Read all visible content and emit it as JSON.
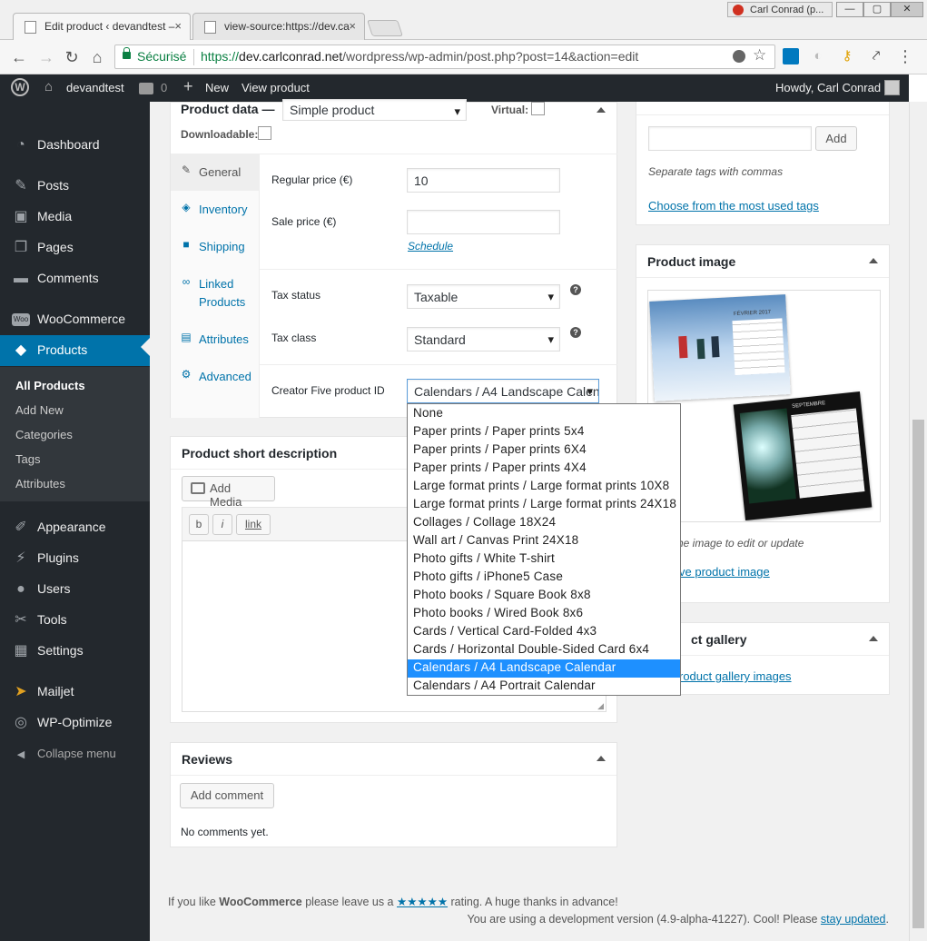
{
  "browser": {
    "tabs": [
      {
        "title": "Edit product ‹ devandtest –",
        "close": "×"
      },
      {
        "title": "view-source:https://dev.ca",
        "close": "×"
      }
    ],
    "profile": "Carl Conrad (p...",
    "window_buttons": [
      "—",
      "▢",
      "✕"
    ],
    "nav": {
      "back": "←",
      "forward": "→",
      "reload": "↻",
      "home": "⌂"
    },
    "security_label": "Sécurisé",
    "url": {
      "scheme": "https://",
      "host": "dev.carlconrad.net",
      "path": "/wordpress/wp-admin/post.php?post=14&action=edit"
    },
    "bookmark_star": "☆",
    "menu_dots": "⋮"
  },
  "adminbar": {
    "site_name": "devandtest",
    "comments_count": "0",
    "new_label": "New",
    "view_label": "View product",
    "howdy": "Howdy, Carl Conrad"
  },
  "sidebar": {
    "items": [
      {
        "label": "Dashboard",
        "icon": "◔"
      },
      {
        "label": "Posts",
        "icon": "✎"
      },
      {
        "label": "Media",
        "icon": "▣"
      },
      {
        "label": "Pages",
        "icon": "❐"
      },
      {
        "label": "Comments",
        "icon": "▬"
      },
      {
        "label": "WooCommerce",
        "icon": "Woo"
      },
      {
        "label": "Products",
        "icon": "◆"
      },
      {
        "label": "Appearance",
        "icon": "✐"
      },
      {
        "label": "Plugins",
        "icon": "⚡"
      },
      {
        "label": "Users",
        "icon": "●"
      },
      {
        "label": "Tools",
        "icon": "✂"
      },
      {
        "label": "Settings",
        "icon": "▦"
      },
      {
        "label": "Mailjet",
        "icon": "➤"
      },
      {
        "label": "WP-Optimize",
        "icon": "◎"
      },
      {
        "label": "Collapse menu",
        "icon": "◀"
      }
    ],
    "submenu": [
      "All Products",
      "Add New",
      "Categories",
      "Tags",
      "Attributes"
    ]
  },
  "product_data": {
    "title": "Product data —",
    "type_value": "Simple product",
    "virtual_label": "Virtual:",
    "downloadable_label": "Downloadable:",
    "tabs": [
      {
        "label": "General",
        "icon": "✎"
      },
      {
        "label": "Inventory",
        "icon": "◈"
      },
      {
        "label": "Shipping",
        "icon": "■"
      },
      {
        "label": "Linked Products",
        "icon": "∞"
      },
      {
        "label": "Attributes",
        "icon": "▤"
      },
      {
        "label": "Advanced",
        "icon": "⚙"
      }
    ],
    "regular_price_label": "Regular price (€)",
    "regular_price_value": "10",
    "sale_price_label": "Sale price (€)",
    "sale_price_value": "",
    "schedule_link": "Schedule",
    "tax_status_label": "Tax status",
    "tax_status_value": "Taxable",
    "tax_class_label": "Tax class",
    "tax_class_value": "Standard",
    "help_icon": "?",
    "creator_label": "Creator Five product ID",
    "creator_value": "Calendars / A4 Landscape Calendar",
    "creator_options": [
      "None",
      "Paper prints / Paper prints 5x4",
      "Paper prints / Paper prints 6X4",
      "Paper prints / Paper prints 4X4",
      "Large format prints / Large format prints 10X8",
      "Large format prints / Large format prints 24X18",
      "Collages / Collage 18X24",
      "Wall art / Canvas Print 24X18",
      "Photo gifts / White T-shirt",
      "Photo gifts / iPhone5 Case",
      "Photo books / Square Book 8x8",
      "Photo books / Wired Book 8x6",
      "Cards / Vertical Card-Folded 4x3",
      "Cards / Horizontal Double-Sided Card 6x4",
      "Calendars / A4 Landscape Calendar",
      "Calendars / A4 Portrait Calendar"
    ],
    "highlighted_index": 14
  },
  "short_description": {
    "title": "Product short description",
    "add_media": "Add Media",
    "quicktags": [
      "b",
      "i",
      "link"
    ]
  },
  "reviews": {
    "title": "Reviews",
    "add_comment": "Add comment",
    "empty": "No comments yet."
  },
  "tags_box": {
    "add_button": "Add",
    "hint": "Separate tags with commas",
    "choose_link": "Choose from the most used tags"
  },
  "product_image": {
    "title": "Product image",
    "calendar_month_1": "FÉVRIER 2017",
    "calendar_month_2": "SEPTEMBRE",
    "hint": "he image to edit or update",
    "remove_link": "ve product image"
  },
  "product_gallery": {
    "title": "ct gallery",
    "add_link": "roduct gallery images"
  },
  "footer": {
    "woo_prefix": "If you like ",
    "woo_brand": "WooCommerce",
    "woo_mid": " please leave us a ",
    "stars": "★★★★★",
    "woo_suffix": " rating. A huge thanks in advance!",
    "version_text": "You are using a development version (4.9-alpha-41227). Cool! Please ",
    "stay_updated": "stay updated",
    "version_end": "."
  },
  "colors": {
    "accent": "#0073aa",
    "sidebar": "#23282d",
    "highlight": "#1e90ff"
  }
}
